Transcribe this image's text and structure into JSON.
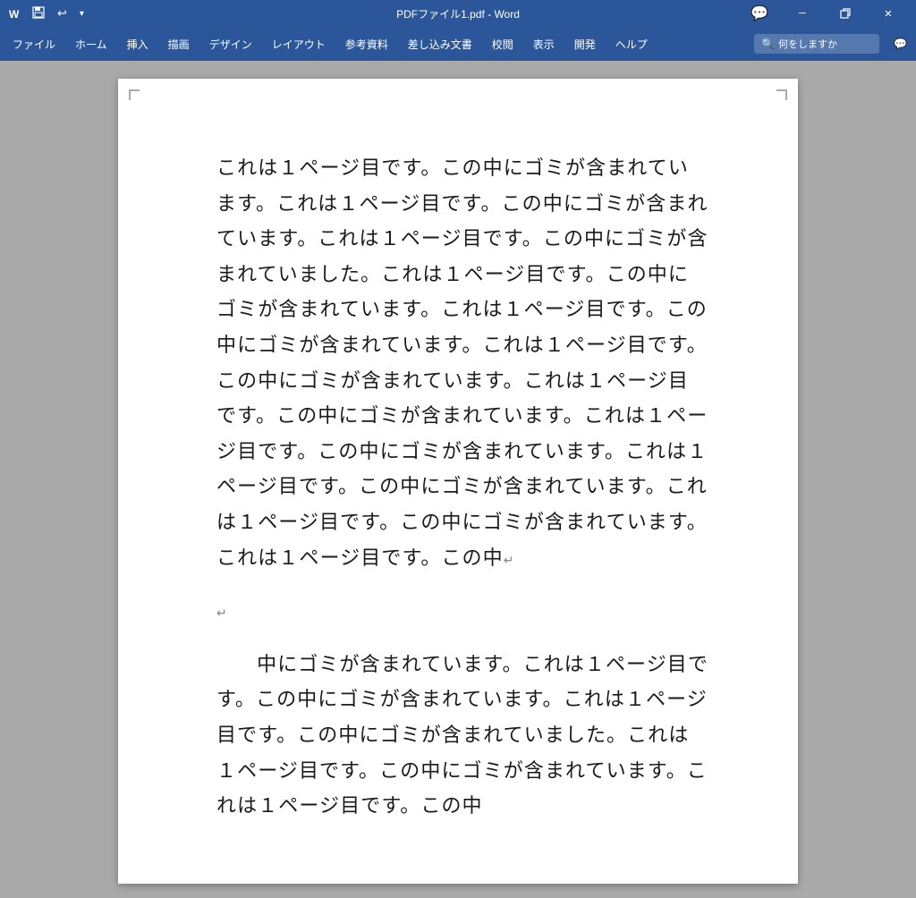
{
  "titlebar": {
    "save_icon": "💾",
    "undo_label": "↩",
    "dropdown_label": "▾",
    "title": "PDFファイル1.pdf - Word",
    "app_name": "Word",
    "minimize_label": "─",
    "restore_label": "⧠",
    "close_label": "✕",
    "comment_label": "💬"
  },
  "ribbon": {
    "tabs": [
      {
        "label": "ファイル"
      },
      {
        "label": "ホーム"
      },
      {
        "label": "挿入"
      },
      {
        "label": "描画"
      },
      {
        "label": "デザイン"
      },
      {
        "label": "レイアウト"
      },
      {
        "label": "参考資料"
      },
      {
        "label": "差し込み文書"
      },
      {
        "label": "校閲"
      },
      {
        "label": "表示"
      },
      {
        "label": "開発"
      },
      {
        "label": "ヘルプ"
      }
    ],
    "search_placeholder": "何をしますか",
    "search_icon": "🔍",
    "comment_icon": "💬"
  },
  "document": {
    "page_text_1": "これは１ページ目です。この中にゴミが含まれています。これは１ページ目です。この中にゴミが含まれています。これは１ページ目です。この中にゴミが含まれていました。これは１ページ目です。この中にゴミが含まれています。これは１ページ目です。この中にゴミが含まれています。これは１ページ目です。この中にゴミが含まれています。これは１ページ目です。この中にゴミが含まれています。これは１ページ目です。この中にゴミが含まれています。これは１ページ目です。この中にゴミが含まれています。これは１ページ目です。この中にゴミが含まれています。これは１ページ目です。この中↵",
    "return_mark_1": "↵",
    "page_text_2": "　中にゴミが含まれています。これは１ページ目です。この中にゴミが含まれています。これは１ページ目です。この中にゴミが含まれていました。これは１ページ目です。この中にゴミが含まれています。これは１ページ目です。この中"
  }
}
